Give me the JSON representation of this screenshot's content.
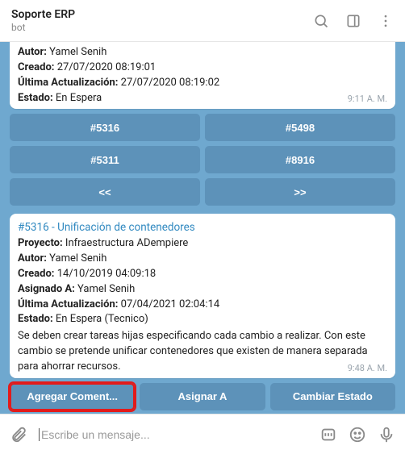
{
  "header": {
    "title": "Soporte ERP",
    "subtitle": "bot"
  },
  "card1": {
    "autor_label": "Autor:",
    "autor_value": "Yamel Senih",
    "creado_label": "Creado:",
    "creado_value": "27/07/2020 08:19:01",
    "update_label": "Última Actualización:",
    "update_value": "27/07/2020 08:19:02",
    "estado_label": "Estado:",
    "estado_value": "En Espera",
    "time": "9:11 A. M."
  },
  "nav": {
    "b1": "#5316",
    "b2": "#5498",
    "b3": "#5311",
    "b4": "#8916",
    "prev": "<<",
    "next": ">>"
  },
  "card2": {
    "title": "#5316 - Unificación de contenedores",
    "proyecto_label": "Proyecto:",
    "proyecto_value": "Infraestructura ADempiere",
    "autor_label": "Autor:",
    "autor_value": "Yamel Senih",
    "creado_label": "Creado:",
    "creado_value": "14/10/2019 04:09:18",
    "asignado_label": "Asignado A:",
    "asignado_value": "Yamel Senih",
    "update_label": "Última Actualización:",
    "update_value": "07/04/2021 02:04:14",
    "estado_label": "Estado:",
    "estado_value": "En Espera (Tecnico)",
    "desc": "Se deben crear tareas hijas especificando cada cambio a realizar. Con este cambio se pretende unificar contenedores que existen de manera separada para ahorrar recursos.",
    "time": "9:48 A. M."
  },
  "actions": {
    "comment": "Agregar Coment...",
    "assign": "Asignar A",
    "state": "Cambiar Estado"
  },
  "composer": {
    "placeholder": "Escribe un mensaje..."
  }
}
